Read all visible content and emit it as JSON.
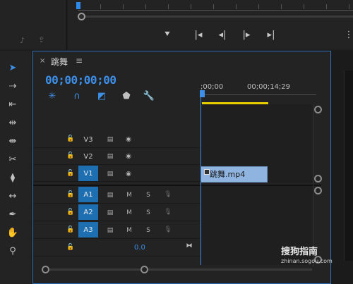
{
  "sequence": {
    "tab_title": "跳舞",
    "timecode": "00;00;00;00",
    "ruler_start": ";00;00",
    "ruler_mark": "00;00;14;29"
  },
  "tracks": {
    "video": [
      {
        "name": "V3",
        "active": false
      },
      {
        "name": "V2",
        "active": false
      },
      {
        "name": "V1",
        "active": true
      }
    ],
    "audio": [
      {
        "name": "A1",
        "active": true,
        "m": "M",
        "s": "S"
      },
      {
        "name": "A2",
        "active": true,
        "m": "M",
        "s": "S"
      },
      {
        "name": "A3",
        "active": true,
        "m": "M",
        "s": "S"
      }
    ],
    "master_value": "0.0"
  },
  "clip": {
    "label": "跳舞.mp4"
  },
  "watermark": {
    "text": "搜狗指南",
    "url": "zhinan.sogou.com"
  },
  "icons": {
    "tab_close": "×",
    "tab_menu": "≡"
  },
  "colors": {
    "accent": "#3c8fe8",
    "clip": "#8fb4e0",
    "work_area": "#e8d000"
  }
}
